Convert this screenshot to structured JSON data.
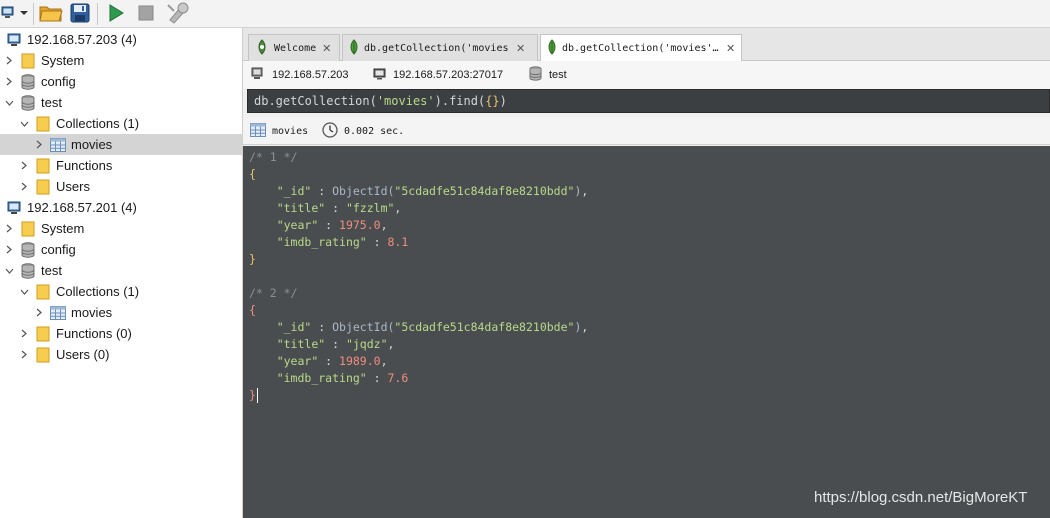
{
  "toolbar": {
    "buttons": [
      {
        "icon": "connect-icon"
      },
      {
        "icon": "dropdown-arrow-icon"
      },
      {
        "icon": "open-folder-icon"
      },
      {
        "icon": "save-icon"
      },
      {
        "icon": "run-icon"
      },
      {
        "icon": "stop-icon"
      },
      {
        "icon": "execute-tools-icon"
      }
    ]
  },
  "sidebar": {
    "servers": [
      {
        "label": "192.168.57.203 (4)",
        "children": {
          "system": "System",
          "config": "config",
          "test": "test",
          "collections": "Collections (1)",
          "movies": "movies",
          "functions": "Functions",
          "users": "Users"
        }
      },
      {
        "label": "192.168.57.201 (4)",
        "children": {
          "system": "System",
          "config": "config",
          "test": "test",
          "collections": "Collections (1)",
          "movies": "movies",
          "functions": "Functions (0)",
          "users": "Users (0)"
        }
      }
    ],
    "selected": "movies"
  },
  "tabs": [
    {
      "label": "Welcome",
      "icon": "robomongo-icon",
      "active": false
    },
    {
      "label": "db.getCollection('movies'…",
      "icon": "leaf-icon",
      "active": false
    },
    {
      "label": "db.getCollection('movies'…",
      "icon": "leaf-icon",
      "active": true
    }
  ],
  "connection": {
    "server": "192.168.57.203",
    "host_port": "192.168.57.203:27017",
    "database": "test"
  },
  "query": {
    "prefix": "db.getCollection(",
    "argument": "'movies'",
    "suffix": ").find(",
    "inner": "{}",
    "close": ")"
  },
  "result_info": {
    "collection": "movies",
    "time": "0.002 sec."
  },
  "results": [
    {
      "comment": "/* 1 */",
      "id_key": "\"_id\"",
      "id_func": "ObjectId(",
      "id_value": "\"5cdadfe51c84daf8e8210bdd\"",
      "title_key": "\"title\"",
      "title_value": "\"fzzlm\"",
      "year_key": "\"year\"",
      "year_value": "1975.0",
      "rating_key": "\"imdb_rating\"",
      "rating_value": "8.1"
    },
    {
      "comment": "/* 2 */",
      "id_key": "\"_id\"",
      "id_func": "ObjectId(",
      "id_value": "\"5cdadfe51c84daf8e8210bde\"",
      "title_key": "\"title\"",
      "title_value": "\"jqdz\"",
      "year_key": "\"year\"",
      "year_value": "1989.0",
      "rating_key": "\"imdb_rating\"",
      "rating_value": "7.6"
    }
  ],
  "syntax": {
    "open_brace": "{",
    "close_brace": "}",
    "colon": " : ",
    "comma": ",",
    "close_paren": ")"
  },
  "watermark": "https://blog.csdn.net/BigMoreKT",
  "colors": {
    "editor_bg": "#4a4d4f",
    "query_bg": "#3c3f41",
    "selected_row": "#d4d4d4",
    "folder": "#f5c842",
    "string": "#b9d98a",
    "number": "#f08d7d"
  }
}
